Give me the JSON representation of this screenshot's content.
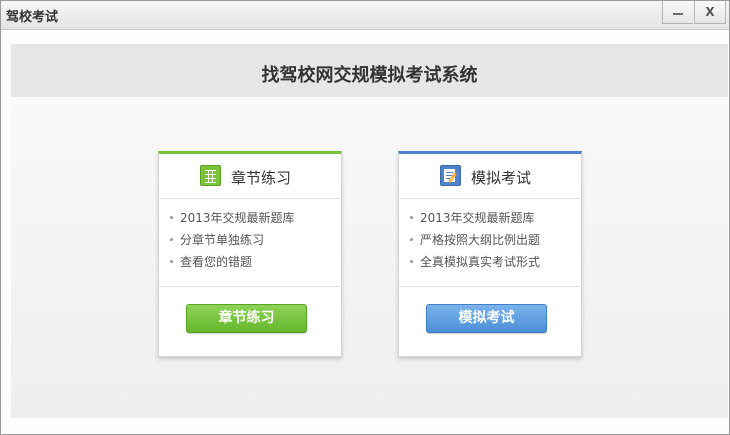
{
  "window": {
    "title": "驾校考试",
    "controls": {
      "minimize": "—",
      "close": "X"
    }
  },
  "header": {
    "title": "找驾校网交规模拟考试系统"
  },
  "cards": [
    {
      "heading": "章节练习",
      "icon": "grid-icon",
      "accent": "#7ac43b",
      "features": [
        "2013年交规最新题库",
        "分章节单独练习",
        "查看您的错题"
      ],
      "button_label": "章节练习"
    },
    {
      "heading": "模拟考试",
      "icon": "exam-sheet-icon",
      "accent": "#4f82c8",
      "features": [
        "2013年交规最新题库",
        "严格按照大纲比例出题",
        "全真模拟真实考试形式"
      ],
      "button_label": "模拟考试"
    }
  ]
}
